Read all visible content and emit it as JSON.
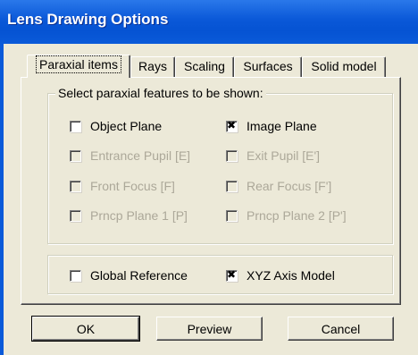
{
  "window": {
    "title": "Lens Drawing Options"
  },
  "tabs": [
    {
      "label": "Paraxial items",
      "active": true
    },
    {
      "label": "Rays"
    },
    {
      "label": "Scaling"
    },
    {
      "label": "Surfaces"
    },
    {
      "label": "Solid model"
    }
  ],
  "paraxial_group": {
    "title": "Select paraxial features to be shown:",
    "options": [
      {
        "label": "Object Plane",
        "checked": false,
        "enabled": true
      },
      {
        "label": "Image Plane",
        "checked": true,
        "enabled": true
      },
      {
        "label": "Entrance Pupil [E]",
        "checked": false,
        "enabled": false
      },
      {
        "label": "Exit Pupil [E']",
        "checked": false,
        "enabled": false
      },
      {
        "label": "Front Focus  [F]",
        "checked": false,
        "enabled": false
      },
      {
        "label": "Rear Focus  [F']",
        "checked": false,
        "enabled": false
      },
      {
        "label": "Prncp Plane 1 [P]",
        "checked": false,
        "enabled": false
      },
      {
        "label": "Prncp Plane 2  [P']",
        "checked": false,
        "enabled": false
      }
    ]
  },
  "reference_group": {
    "global_reference": {
      "label": "Global Reference",
      "checked": false
    },
    "xyz_axis_model": {
      "label": "XYZ Axis Model",
      "checked": true
    }
  },
  "buttons": {
    "ok": "OK",
    "preview": "Preview",
    "cancel": "Cancel"
  }
}
